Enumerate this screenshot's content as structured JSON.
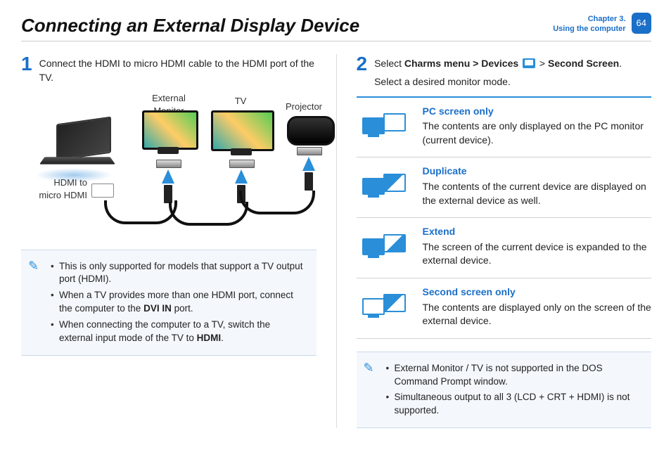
{
  "header": {
    "title": "Connecting an External Display Device",
    "chapter_line1": "Chapter 3.",
    "chapter_line2": "Using the computer",
    "page_number": "64"
  },
  "step1": {
    "number": "1",
    "text_a": "Connect the HDMI to micro HDMI cable to the HDMI port of the TV."
  },
  "diagram": {
    "label_external": "External Monitor",
    "label_tv": "TV",
    "label_projector": "Projector",
    "label_hdmi": "HDMI to micro HDMI"
  },
  "note1": {
    "items": [
      {
        "pre": "This is only supported for models that support a TV output port (HDMI)."
      },
      {
        "pre": "When a TV provides more than one HDMI port, connect the computer to the ",
        "bold": "DVI IN",
        "post": " port."
      },
      {
        "pre": "When connecting the computer to a TV, switch the external input mode of the TV to ",
        "bold": "HDMI",
        "post": "."
      }
    ]
  },
  "step2": {
    "number": "2",
    "pre": "Select ",
    "b1": "Charms menu > Devices",
    "mid": " > ",
    "b2": "Second Screen",
    "post": ".",
    "line2": "Select a desired monitor mode."
  },
  "modes": [
    {
      "icon": "pc",
      "title": "PC screen only",
      "desc": "The contents are only displayed on the PC monitor (current device)."
    },
    {
      "icon": "dup",
      "title": "Duplicate",
      "desc": "The contents of the current device are displayed on the external device as well."
    },
    {
      "icon": "ext",
      "title": "Extend",
      "desc": "The screen of the current device is expanded to the external device."
    },
    {
      "icon": "sec",
      "title": "Second screen only",
      "desc": "The contents are displayed only on the screen of the external device."
    }
  ],
  "note2": {
    "items": [
      {
        "pre": "External Monitor / TV is not supported in the DOS Command Prompt window."
      },
      {
        "pre": "Simultaneous output to all 3 (LCD + CRT + HDMI) is not supported."
      }
    ]
  }
}
